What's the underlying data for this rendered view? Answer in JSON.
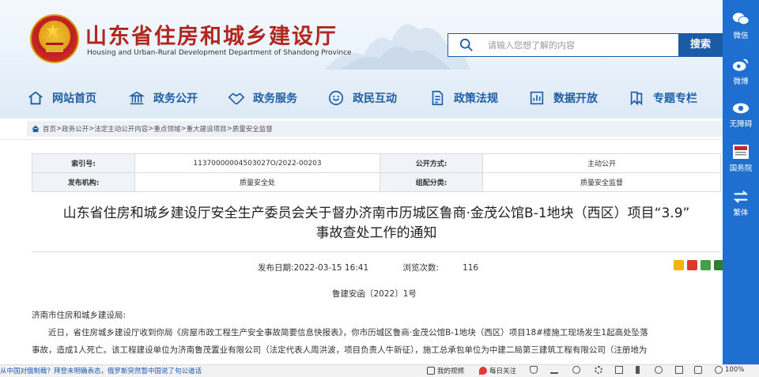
{
  "header": {
    "title": "山东省住房和城乡建设厅",
    "subtitle": "Housing and Urban-Rural Development Department of Shandong Province",
    "search_placeholder": "请输入您想了解的内容",
    "search_button": "搜索"
  },
  "nav": {
    "items": [
      {
        "label": "网站首页",
        "icon": "home-icon"
      },
      {
        "label": "政务公开",
        "icon": "building-icon"
      },
      {
        "label": "政务服务",
        "icon": "handshake-icon"
      },
      {
        "label": "政民互动",
        "icon": "interaction-icon"
      },
      {
        "label": "政策法规",
        "icon": "document-icon"
      },
      {
        "label": "数据开放",
        "icon": "chart-icon"
      },
      {
        "label": "专题专栏",
        "icon": "bookmark-icon"
      }
    ]
  },
  "breadcrumb": {
    "items": [
      "首页",
      "政务公开",
      "法定主动公开内容",
      "重点领域",
      "重大建设项目",
      "质量安全监督"
    ],
    "separator": ">"
  },
  "info": {
    "index_label": "索引号:",
    "index_value": "11370000004503027O/2022-00203",
    "open_mode_label": "公开方式:",
    "open_mode_value": "主动公开",
    "publisher_label": "发布机构:",
    "publisher_value": "质量安全处",
    "org_label": "组配分类:",
    "org_value": "质量安全监督"
  },
  "document": {
    "title_line1": "山东省住房和城乡建设厅安全生产委员会关于督办济南市历城区鲁商·金茂公馆B-1地块（西区）项目“3.9”",
    "title_line2": "事故查处工作的通知",
    "date_label": "发布日期:",
    "date_value": "2022-03-15 16:41",
    "views_label": "浏览次数:",
    "views_value": "116",
    "doc_number": "鲁建安函〔2022〕1号",
    "addressee": "济南市住房和城乡建设局:",
    "para1_line1": "近日，省住房城乡建设厅收到你局《房屋市政工程生产安全事故简要信息快报表》，你市历城区鲁商·金茂公馆B-1地块（西区）项目18#楼施工现场发生1起高处坠落",
    "para1_line2": "事故，造成1人死亡。该工程建设单位为济南鲁茂置业有限公司（法定代表人周洪波，项目负责人牛新征），施工总承包单位为中建二局第三建筑工程有限公司（注册地为"
  },
  "sidebar": {
    "items": [
      {
        "label": "微信",
        "icon": "wechat-icon"
      },
      {
        "label": "微博",
        "icon": "weibo-icon"
      },
      {
        "label": "无障碍",
        "icon": "accessibility-icon"
      },
      {
        "label": "国务院",
        "icon": "state-council-icon"
      },
      {
        "label": "繁体",
        "icon": "traditional-chinese-icon"
      }
    ]
  },
  "statusbar": {
    "news": "从中国对俄制裁？拜登未明确表态，俄罗斯突然暂中国说了句公道话",
    "video": "我的视频",
    "daily": "每日关注",
    "zoom": "100%"
  }
}
